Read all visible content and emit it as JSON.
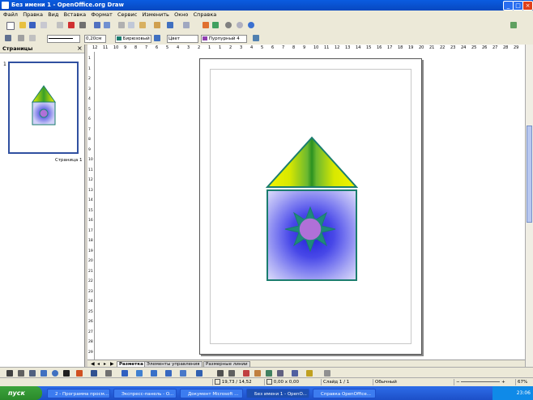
{
  "window": {
    "title": "Без имени 1 - OpenOffice.org Draw"
  },
  "menu": [
    "Файл",
    "Правка",
    "Вид",
    "Вставка",
    "Формат",
    "Сервис",
    "Изменить",
    "Окно",
    "Справка"
  ],
  "toolbar2": {
    "line_width": "0,20см",
    "area_color": "Бирюзовый",
    "fill_type": "Цвет",
    "fill_color": "Пурпурный 4"
  },
  "pages_panel": {
    "title": "Страницы",
    "page_number": "1",
    "thumb_label": "Страница 1"
  },
  "ruler_h": [
    "12",
    "11",
    "10",
    "9",
    "8",
    "7",
    "6",
    "5",
    "4",
    "3",
    "2",
    "1",
    "1",
    "2",
    "3",
    "4",
    "5",
    "6",
    "7",
    "8",
    "9",
    "10",
    "11",
    "12",
    "13",
    "14",
    "15",
    "16",
    "17",
    "18",
    "19",
    "20",
    "21",
    "22",
    "23",
    "24",
    "25",
    "26",
    "27",
    "28",
    "29"
  ],
  "ruler_v": [
    "1",
    "1",
    "2",
    "3",
    "4",
    "5",
    "6",
    "7",
    "8",
    "9",
    "10",
    "11",
    "12",
    "13",
    "14",
    "15",
    "16",
    "17",
    "18",
    "19",
    "20",
    "21",
    "22",
    "23",
    "24",
    "25",
    "26",
    "27",
    "28",
    "29"
  ],
  "tabs": [
    "Разметка",
    "Элементы управления",
    "Размерные линии"
  ],
  "status": {
    "position": "19,73 / 14,52",
    "size": "0,00 x 0,00",
    "slide": "Слайд 1 / 1",
    "layout": "Обычный",
    "zoom": "67%"
  },
  "taskbar": {
    "start": "пуск",
    "tasks": [
      "2 - Программа просм...",
      "Экспресс-панель - O...",
      "Документ Microsoft ...",
      "Без имени 1 - OpenO...",
      "Справка OpenOffice..."
    ],
    "clock": "23:06"
  },
  "colors": {
    "triangle_top": "#f0f000",
    "triangle_mid": "#3aa028",
    "border": "#1b7d6e",
    "disc_outer": "#c8c8f8",
    "disc_inner": "#4040e0",
    "star": "#1f8a7a",
    "circle": "#b070d8"
  }
}
